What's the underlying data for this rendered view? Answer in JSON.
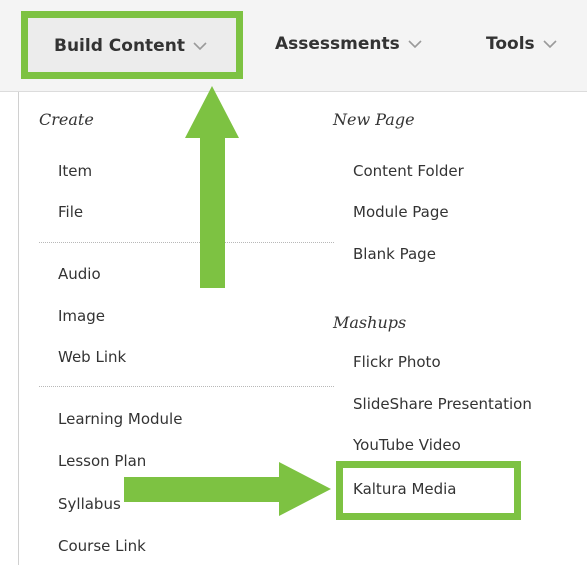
{
  "tabs": [
    {
      "label": "Build Content"
    },
    {
      "label": "Assessments"
    },
    {
      "label": "Tools"
    }
  ],
  "menu": {
    "create": {
      "heading": "Create",
      "items": [
        "Item",
        "File",
        "Audio",
        "Image",
        "Web Link",
        "Learning Module",
        "Lesson Plan",
        "Syllabus",
        "Course Link"
      ]
    },
    "new_page": {
      "heading": "New Page",
      "items": [
        "Content Folder",
        "Module Page",
        "Blank Page"
      ]
    },
    "mashups": {
      "heading": "Mashups",
      "items": [
        "Flickr Photo",
        "SlideShare Presentation",
        "YouTube Video",
        "Kaltura Media"
      ]
    }
  },
  "colors": {
    "highlight": "#7dc242",
    "text": "#333333",
    "chevron": "#9a9a9a"
  }
}
